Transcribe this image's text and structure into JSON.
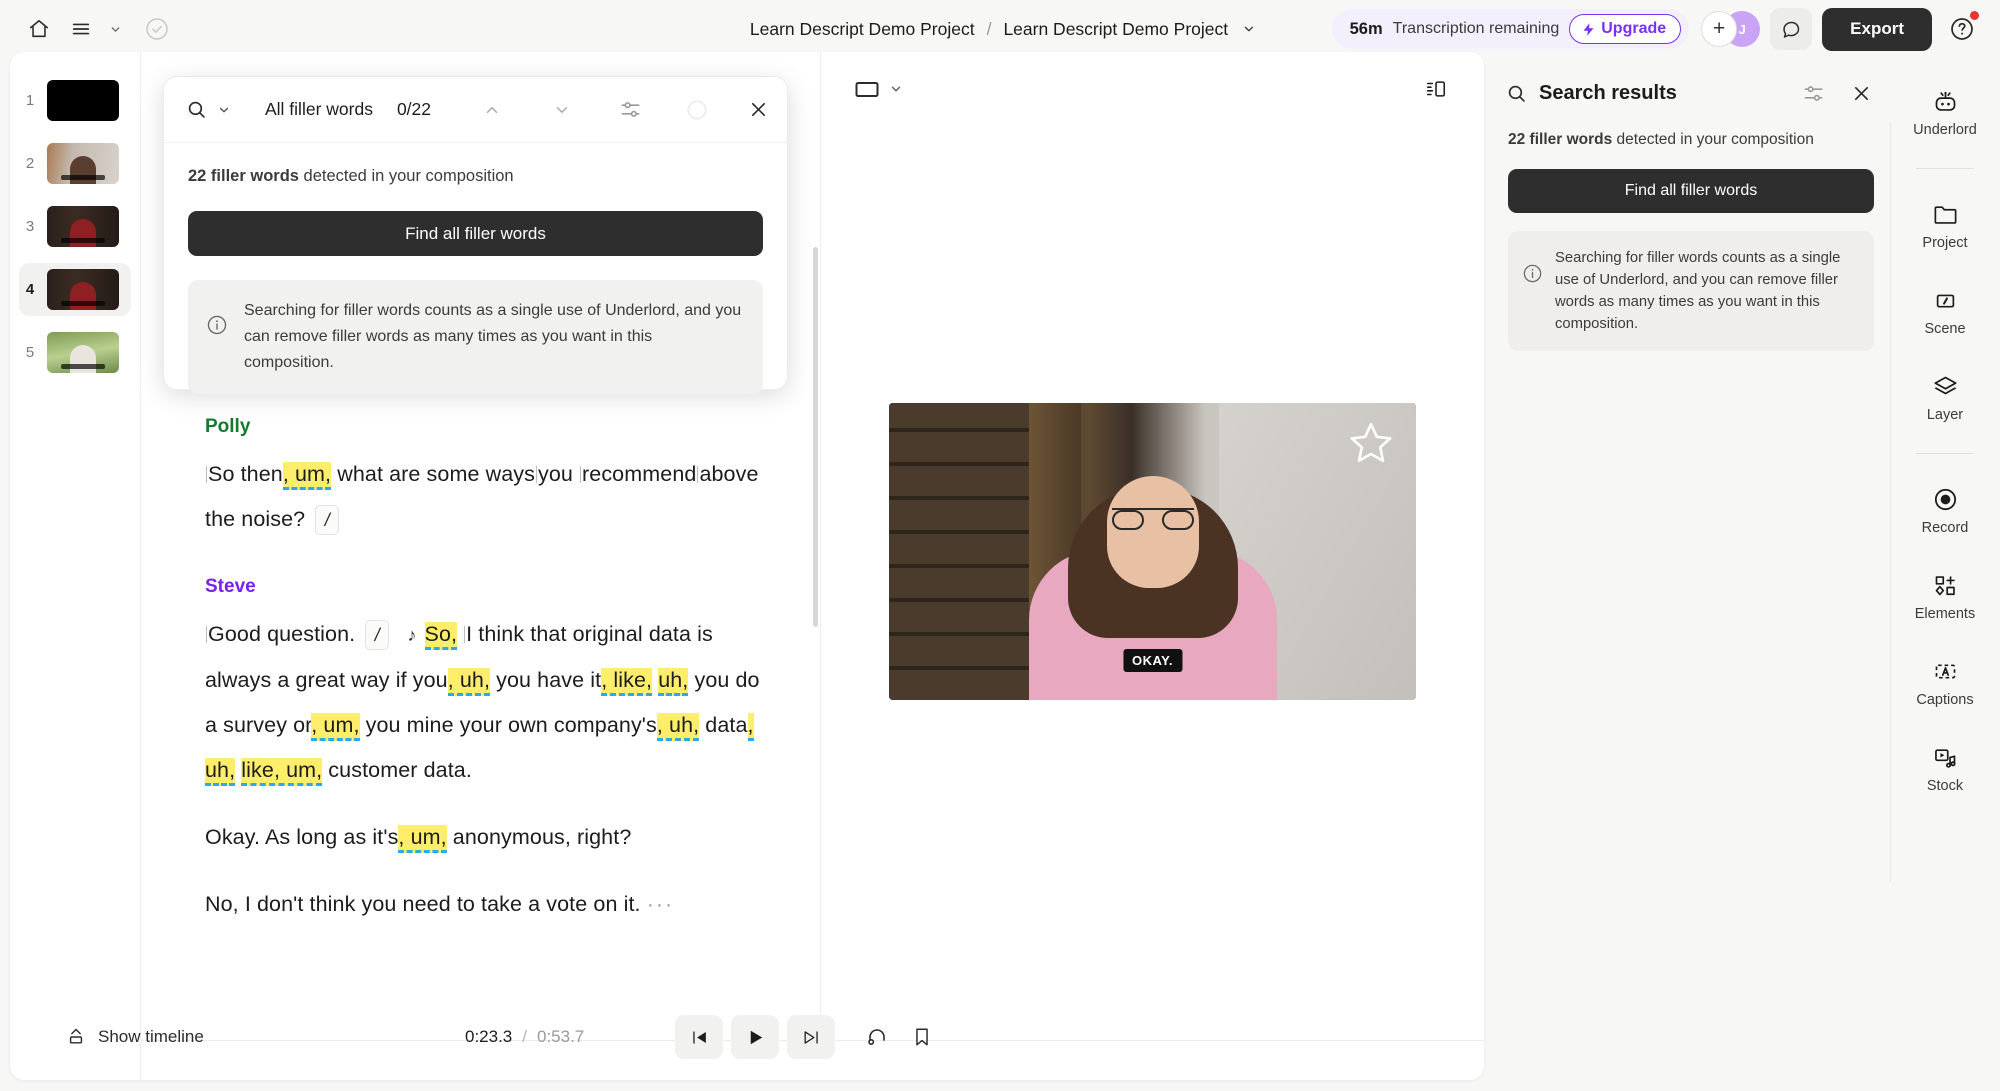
{
  "header": {
    "home_icon": "home-icon",
    "menu_icon": "hamburger-menu-icon",
    "menu_chevron": "chevron-down-icon",
    "check_icon": "check-circle-icon",
    "breadcrumb_project": "Learn Descript Demo Project",
    "breadcrumb_sep": "/",
    "breadcrumb_composition": "Learn Descript Demo Project",
    "breadcrumb_chevron": "chevron-down-icon",
    "transcription_minutes": "56m",
    "transcription_label": "Transcription remaining",
    "upgrade_label": "Upgrade",
    "upgrade_icon": "lightning-bolt-icon",
    "add_member": "+",
    "avatar_initial": "J",
    "comment_icon": "comment-bubble-icon",
    "export_label": "Export",
    "help_icon": "question-mark-icon",
    "accent_purple": "#7b2ff7",
    "export_bg": "#2e2e2e"
  },
  "thumbnails": [
    {
      "num": "1"
    },
    {
      "num": "2"
    },
    {
      "num": "3"
    },
    {
      "num": "4"
    },
    {
      "num": "5"
    }
  ],
  "thumbnails_active_index": 3,
  "search_popover": {
    "search_icon": "search-icon",
    "dropdown_chevron": "chevron-down-icon",
    "query": "All filler words",
    "match_count": "0/22",
    "prev_icon": "chevron-up-icon",
    "next_icon": "chevron-down-icon",
    "settings_icon": "sliders-icon",
    "loading_icon": "circle-icon",
    "close_icon": "close-x-icon",
    "detected_bold": "22 filler words",
    "detected_rest": " detected in your composition",
    "find_button": "Find all filler words",
    "info_icon": "info-circle-icon",
    "info_text": "Searching for filler words counts as a single use of Underlord, and you can remove filler words as many times as you want in this composition."
  },
  "transcript": {
    "scene_chip": "/",
    "blocks": [
      {
        "speaker": "Polly",
        "speaker_color": "#167a2e",
        "text": "So then, um, what are some ways you recommend above the noise? /"
      },
      {
        "speaker": "Steve",
        "speaker_color": "#7a1ff0",
        "text": "Good question. / ♫ So, I think that original data is always a great way if you, uh, you have it, like, uh, you do a survey or, um, you mine your own company's, uh, data, uh, like, um, customer data."
      }
    ],
    "paragraph_3": "Okay. As long as it's, um, anonymous, right?",
    "paragraph_4": "No, I don't think you need to take a vote on it.",
    "paragraph_4_ellipsis": "···",
    "filler_words": [
      "um",
      "So,",
      "uh",
      "like",
      "uh",
      "um",
      "uh",
      "uh",
      "like,",
      "um,",
      "um"
    ],
    "highlight_color": "#ffee6b",
    "underline_color": "#2aa8f0"
  },
  "video": {
    "aspect_icon": "aspect-ratio-icon",
    "aspect_chevron": "chevron-down-icon",
    "layout_icon": "panel-layout-icon",
    "star_icon": "star-icon",
    "caption": "OKAY."
  },
  "transport": {
    "show_timeline_icon": "timeline-expand-icon",
    "show_timeline_label": "Show timeline",
    "current_time": "0:23.3",
    "time_sep": "/",
    "total_time": "0:53.7",
    "skip_back_icon": "skip-to-start-icon",
    "play_icon": "play-icon",
    "skip_forward_icon": "skip-to-end-icon",
    "loop_icon": "loop-icon",
    "bookmark_icon": "bookmark-icon"
  },
  "results_panel": {
    "search_icon": "search-icon",
    "title": "Search results",
    "settings_icon": "sliders-icon",
    "close_icon": "close-x-icon",
    "detected_bold": "22 filler words",
    "detected_rest": " detected in your composition",
    "find_button": "Find all filler words",
    "info_icon": "info-circle-icon",
    "info_text": "Searching for filler words counts as a single use of Underlord, and you can remove filler words as many times as you want in this composition."
  },
  "tool_rail": [
    {
      "label": "Underlord",
      "icon": "robot-icon"
    },
    {
      "label": "Project",
      "icon": "folder-icon"
    },
    {
      "label": "Scene",
      "icon": "scene-slash-icon"
    },
    {
      "label": "Layer",
      "icon": "layers-icon"
    },
    {
      "label": "Record",
      "icon": "record-circle-icon"
    },
    {
      "label": "Elements",
      "icon": "elements-shapes-icon"
    },
    {
      "label": "Captions",
      "icon": "captions-a-icon"
    },
    {
      "label": "Stock",
      "icon": "stock-media-icon"
    }
  ]
}
